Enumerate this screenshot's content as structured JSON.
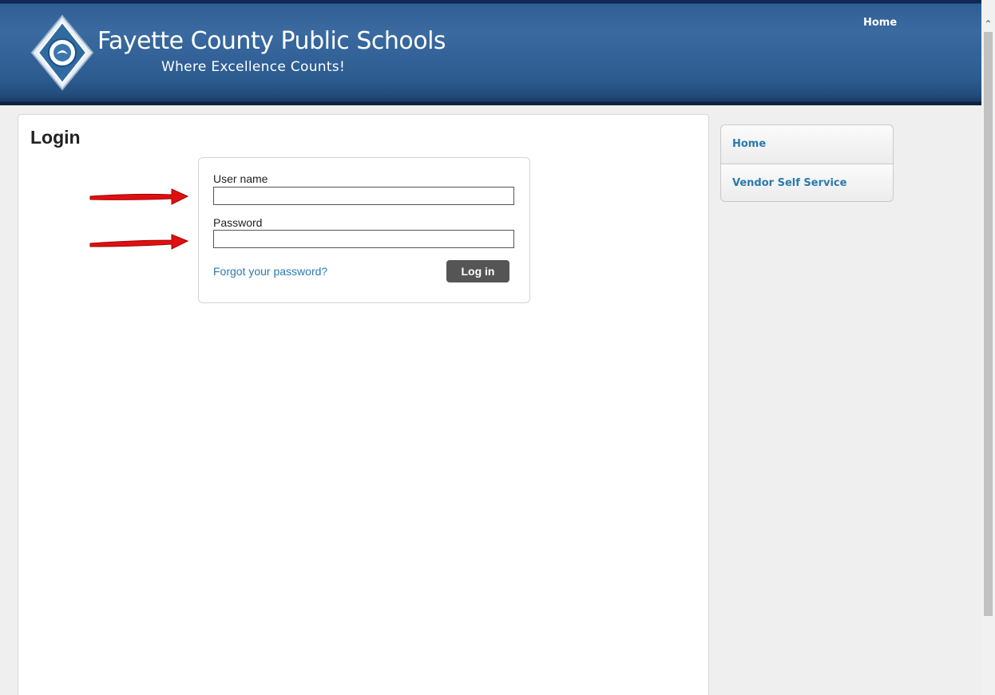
{
  "header": {
    "title": "Fayette County Public Schools",
    "tagline": "Where Excellence Counts!",
    "nav_home": "Home"
  },
  "main": {
    "page_title": "Login",
    "username_label": "User name",
    "username_value": "",
    "password_label": "Password",
    "password_value": "",
    "forgot_link": "Forgot your password?",
    "login_button": "Log in"
  },
  "sidebar": {
    "items": [
      {
        "label": "Home"
      },
      {
        "label": "Vendor Self Service"
      }
    ]
  },
  "colors": {
    "header_blue": "#2f5f94",
    "link_blue": "#2a7ab0",
    "button_gray": "#555555",
    "annotation_arrow": "#e01010"
  },
  "icons": {
    "logo": "school-emblem-icon",
    "scroll_up": "chevron-up-icon"
  }
}
